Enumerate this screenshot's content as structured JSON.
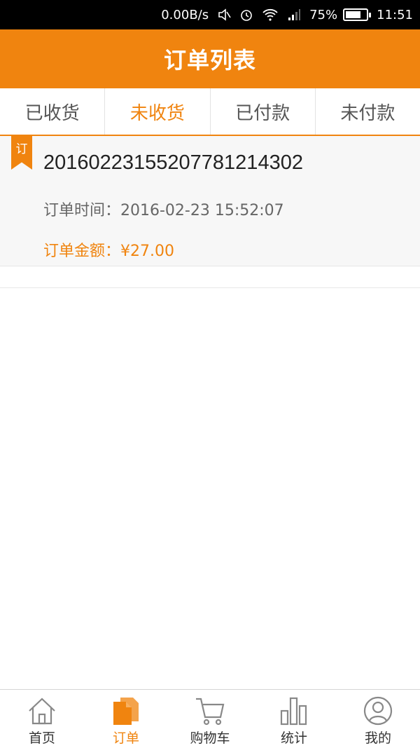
{
  "status_bar": {
    "speed": "0.00B/s",
    "battery": "75%",
    "time": "11:51",
    "battery_level": 0.75
  },
  "header": {
    "title": "订单列表"
  },
  "tabs": [
    {
      "label": "已收货",
      "active": false
    },
    {
      "label": "未收货",
      "active": true
    },
    {
      "label": "已付款",
      "active": false
    },
    {
      "label": "未付款",
      "active": false
    }
  ],
  "orders": [
    {
      "badge": "订",
      "number": "20160223155207781214302",
      "time": "订单时间：2016-02-23 15:52:07",
      "amount": "订单金额：¥27.00"
    }
  ],
  "bottom_nav": [
    {
      "label": "首页",
      "icon": "home-icon",
      "active": false
    },
    {
      "label": "订单",
      "icon": "document-icon",
      "active": true
    },
    {
      "label": "购物车",
      "icon": "cart-icon",
      "active": false
    },
    {
      "label": "统计",
      "icon": "bar-chart-icon",
      "active": false
    },
    {
      "label": "我的",
      "icon": "user-icon",
      "active": false
    }
  ],
  "colors": {
    "accent": "#f0840f",
    "text": "#222222",
    "muted": "#666666"
  }
}
